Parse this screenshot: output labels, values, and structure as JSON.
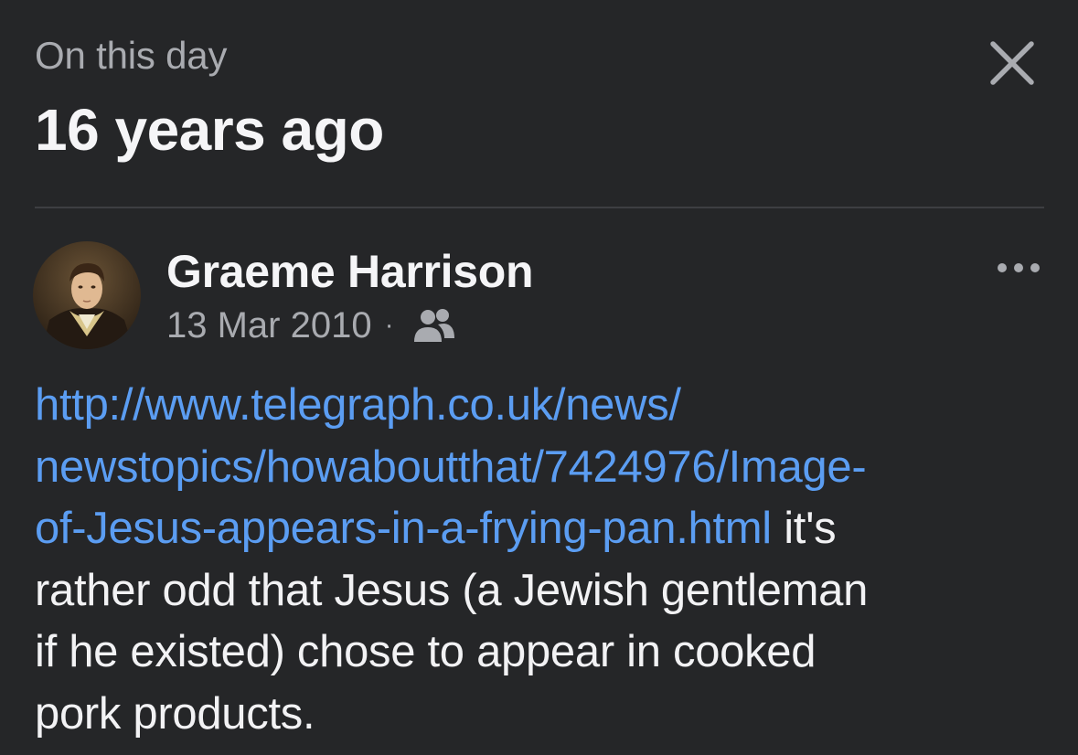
{
  "header": {
    "kicker": "On this day",
    "title": "16 years ago",
    "close_icon": "close-icon"
  },
  "post": {
    "author": "Graeme Harrison",
    "date": "13 Mar 2010",
    "separator": "·",
    "audience_icon": "friends-icon",
    "more_icon": "more-options-icon",
    "link_line1": "http://www.telegraph.co.uk/news/",
    "link_line2": "newstopics/howaboutthat/7424976/Image-",
    "link_line3": "of-Jesus-appears-in-a-frying-pan.html",
    "text_line3_tail": " it's",
    "text_line4": "rather odd that Jesus (a Jewish gentleman",
    "text_line5": "if he existed) chose to appear in cooked",
    "text_line6": "pork products."
  },
  "colors": {
    "background": "#252628",
    "link": "#5b9df2",
    "secondary_text": "#a9abb0",
    "primary_text": "#f2f2f4"
  }
}
